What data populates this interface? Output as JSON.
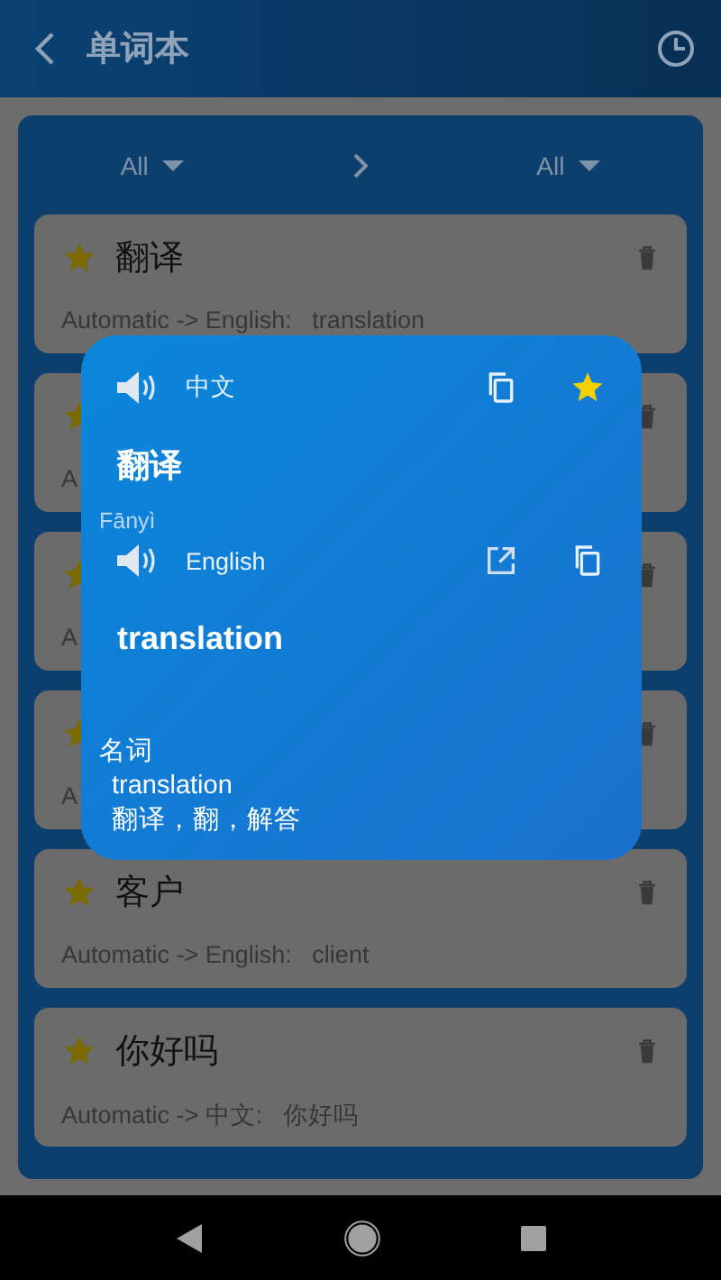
{
  "header": {
    "title": "单词本"
  },
  "filter": {
    "source": "All",
    "target": "All"
  },
  "entries": [
    {
      "word": "翻译",
      "starred": true,
      "detail": "Automatic -> English:   translation"
    },
    {
      "starred": true,
      "detail": "A"
    },
    {
      "starred": true,
      "detail": "A"
    },
    {
      "starred": true,
      "detail": "A"
    },
    {
      "word": "客户",
      "starred": true,
      "detail": "Automatic -> English:   client"
    },
    {
      "word": "你好吗",
      "starred": true,
      "detail": "Automatic -> 中文:   你好吗"
    }
  ],
  "popup": {
    "source": {
      "language": "中文",
      "text": "翻译",
      "phonetic": "Fānyì",
      "starred": true
    },
    "target": {
      "language": "English",
      "text": "translation"
    },
    "definitions": [
      {
        "pos": "名词",
        "term": "translation",
        "meanings": "翻译，翻，解答"
      }
    ]
  }
}
